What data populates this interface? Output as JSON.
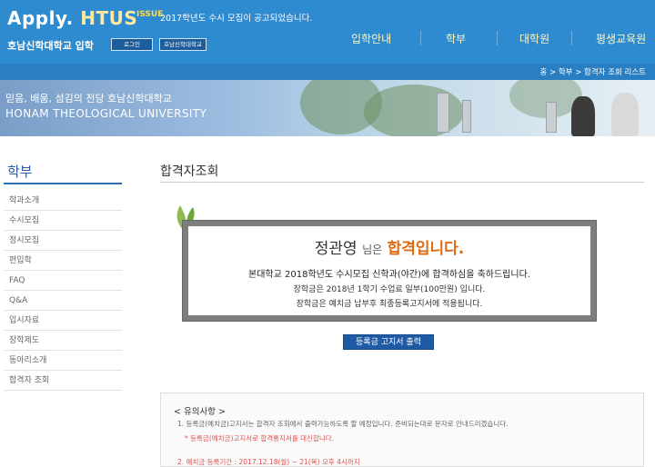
{
  "header": {
    "logo_main": "Apply.",
    "logo_accent": "HTUS",
    "issue_label": "ISSUE",
    "issue_text": "2017학년도 수시 모집이 공고되었습니다.",
    "subtitle": "호남신학대학교 입학",
    "buttons": [
      "로그인",
      "호남신학대학교"
    ],
    "nav": [
      "입학안내",
      "학부",
      "대학원",
      "평생교육원"
    ]
  },
  "breadcrumb": "홈 > 학부 > 합격자 조회 리스트",
  "banner": {
    "korean": "믿음, 배움, 섬김의 전당 호남신학대학교",
    "english": "HONAM THEOLOGICAL UNIVERSITY"
  },
  "sidebar": {
    "title": "학부",
    "items": [
      "학과소개",
      "수시모집",
      "정시모집",
      "편입학",
      "FAQ",
      "Q&A",
      "입시자료",
      "장학제도",
      "동아리소개",
      "합격자 조회"
    ]
  },
  "main": {
    "title": "합격자조회",
    "result": {
      "name": "정관영",
      "suffix": "님은",
      "status": "합격입니다.",
      "line1": "본대학교 2018학년도 수시모집 신학과(야간)에 합격하심을 축하드립니다.",
      "line2": "장학금은 2018년 1학기 수업료 일부(100만원) 입니다.",
      "line3": "장학금은 예치금 납부후 최종등록고지서에 적용됩니다."
    },
    "print_button": "등록금 고지서 출력",
    "notice": {
      "title": "< 유의사항 >",
      "item1": "1. 등록금(예치금)고지서는 합격자 조회에서 출력가능하도록 할 예정입니다. 준비되는대로 문자로 안내드리겠습니다.",
      "item1_note": "* 등록금(예치금)고지서로 합격통지서를 대신합니다.",
      "item2": "2. 예치금 등록기간 : 2017.12.18(월) ~ 21(목) 오후 4시까지"
    }
  },
  "colors": {
    "header_blue": "#2f8bd0",
    "accent_orange": "#e16a14",
    "button_blue": "#1f5aa5"
  }
}
